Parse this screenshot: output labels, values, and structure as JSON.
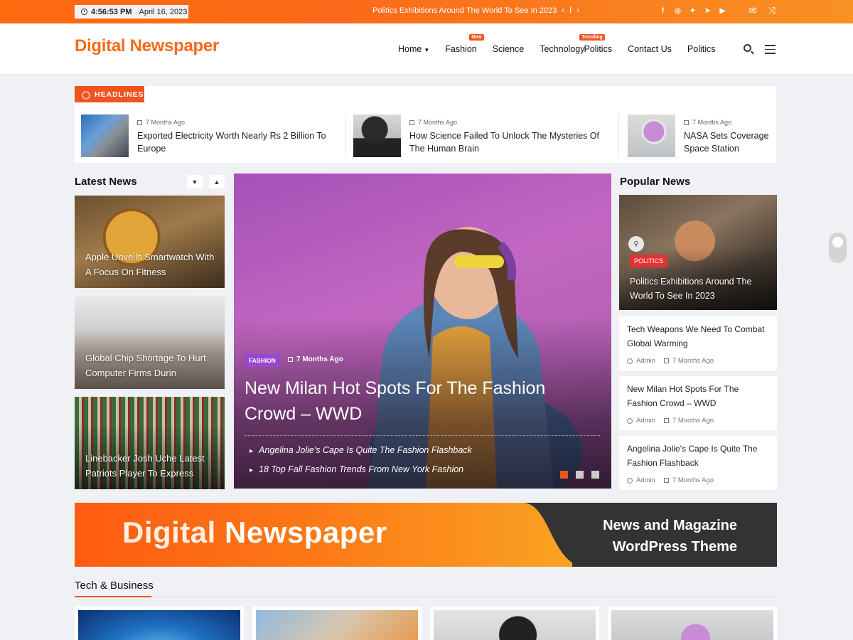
{
  "topbar": {
    "time": "4:56:53 PM",
    "date": "April 16, 2023",
    "ticker": "Politics Exhibitions Around The World To See In 2023",
    "prev": "‹",
    "pause": "I",
    "next": "›",
    "social_icons": [
      "facebook-icon",
      "instagram-icon",
      "twitter-icon",
      "telegram-icon",
      "youtube-icon"
    ],
    "right_icons": [
      "mail-icon",
      "shuffle-icon"
    ]
  },
  "header": {
    "logo": "Digital Newspaper",
    "nav": [
      {
        "label": "Home",
        "badge": ""
      },
      {
        "label": "Fashion",
        "badge": "New"
      },
      {
        "label": "Science",
        "badge": ""
      },
      {
        "label": "Technology",
        "badge": "Trending"
      },
      {
        "label": "Politics",
        "badge": ""
      },
      {
        "label": "Contact Us",
        "badge": ""
      },
      {
        "label": "Politics",
        "badge": ""
      }
    ]
  },
  "headlines": {
    "tag": "HEADLINES",
    "items": [
      {
        "time": "7 Months Ago",
        "title": "Exported Electricity Worth Nearly Rs 2 Billion To Europe"
      },
      {
        "time": "7 Months Ago",
        "title": "How Science Failed To Unlock The Mysteries Of The Human Brain"
      },
      {
        "time": "7 Months Ago",
        "title": "NASA Sets Coverage Space Station"
      }
    ]
  },
  "latest": {
    "title": "Latest News",
    "items": [
      "Apple Unveils Smartwatch With A Focus On Fitness",
      "Global Chip Shortage To Hurt Computer Firms Durin",
      "Linebacker Josh Uche Latest Patriots Player To Express"
    ]
  },
  "slider": {
    "tag": "FASHION",
    "time": "7 Months Ago",
    "title": "New Milan Hot Spots For The Fashion Crowd – WWD",
    "links": [
      "Angelina Jolie's Cape Is Quite The Fashion Flashback",
      "18 Top Fall Fashion Trends From New York Fashion"
    ],
    "active_slide": 1,
    "slide_count": 3
  },
  "popular": {
    "title": "Popular News",
    "main": {
      "tag": "POLITICS",
      "title": "Politics Exhibitions Around The World To See In 2023"
    },
    "items": [
      {
        "title": "Tech Weapons We Need To Combat Global Warming",
        "author": "Admin",
        "time": "7 Months Ago"
      },
      {
        "title": "New Milan Hot Spots For The Fashion Crowd – WWD",
        "author": "Admin",
        "time": "7 Months Ago"
      },
      {
        "title": "Angelina Jolie's Cape Is Quite The Fashion Flashback",
        "author": "Admin",
        "time": "7 Months Ago"
      }
    ]
  },
  "banner": {
    "logo_a": "Digital",
    "logo_b": "Newspaper",
    "line1": "News and Magazine",
    "line2": "WordPress Theme"
  },
  "tech_business": {
    "title": "Tech & Business"
  },
  "colors": {
    "accent": "#f0541e",
    "fashion_tag": "#9a46d1",
    "politics_tag": "#e33232"
  }
}
